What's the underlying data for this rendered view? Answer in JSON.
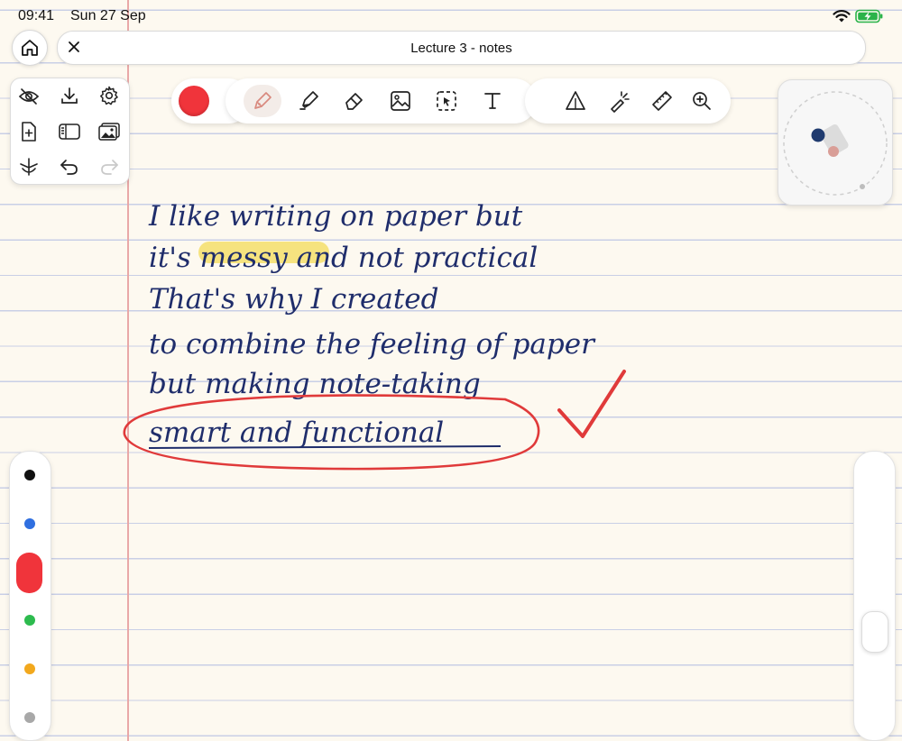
{
  "status_bar": {
    "time": "09:41",
    "date": "Sun 27 Sep",
    "wifi": "wifi-icon",
    "battery": "battery-charging-icon"
  },
  "header": {
    "title": "Lecture 3 - notes",
    "home_icon": "home-icon",
    "close_icon": "close-icon"
  },
  "tools_panel": {
    "icons": [
      "eye-slash-icon",
      "download-icon",
      "gear-icon",
      "add-page-icon",
      "sidebar-icon",
      "photos-icon",
      "pen-nib-anchor-icon",
      "undo-icon",
      "redo-icon"
    ]
  },
  "main_toolbar": {
    "active_color": "#f0343b",
    "active_tool": "pen",
    "tools": [
      "pen-icon",
      "highlighter-icon",
      "eraser-icon",
      "image-icon",
      "lasso-select-icon",
      "text-icon",
      "shapes-icon",
      "laser-pointer-icon",
      "ruler-icon",
      "zoom-icon"
    ]
  },
  "note": {
    "lines": [
      "I like writing on paper but",
      "it's messy and not practical",
      "That's why I created",
      "to combine the feeling of paper",
      "but making note-taking",
      "smart and functional"
    ],
    "ink_color": "#1f2d6b",
    "highlight_word": "messy",
    "highlight_color": "#f5df6b",
    "circle_color": "#e03a3a",
    "checkmark_color": "#e03a3a"
  },
  "color_rail": {
    "colors": [
      "#111111",
      "#2f6fe0",
      "#f0343b",
      "#2dbb4e",
      "#f2a81d",
      "#a8a8a8"
    ],
    "selected": "#f0343b"
  }
}
